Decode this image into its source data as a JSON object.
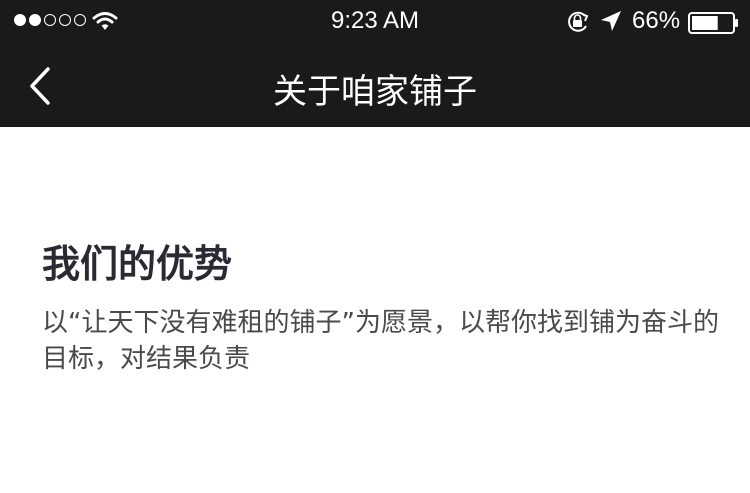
{
  "status_bar": {
    "time": "9:23 AM",
    "battery_percent": "66%",
    "battery_level": 0.66,
    "signal_bars_filled": 2,
    "signal_bars_total": 5,
    "icons": [
      "wifi-icon",
      "orientation-lock-icon",
      "location-arrow-icon",
      "battery-icon"
    ]
  },
  "nav": {
    "title": "关于咱家铺子",
    "back_icon": "chevron-left-icon"
  },
  "section": {
    "title": "我们的优势",
    "description": "以“让天下没有难租的铺子”为愿景，以帮你找到铺为奋斗的目标，对结果负责"
  },
  "colors": {
    "header_bg": "#1a1a1a",
    "header_text": "#ffffff",
    "body_bg": "#ffffff",
    "title_text": "#2a2a35",
    "body_text": "#4a4a4a"
  }
}
